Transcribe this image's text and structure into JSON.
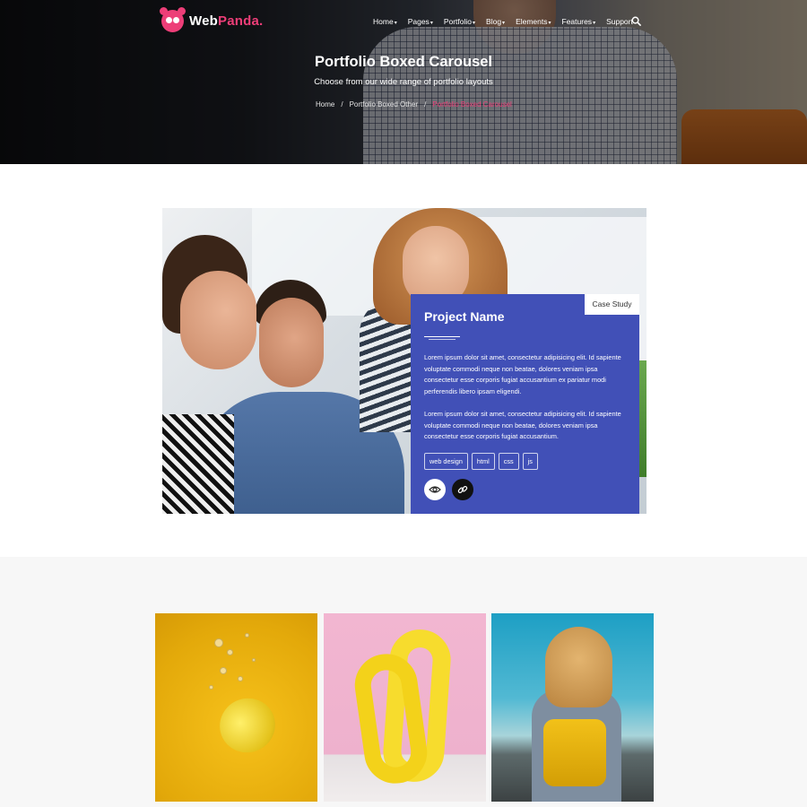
{
  "brand": {
    "name_part1": "Web",
    "name_part2": "Panda.",
    "accent": "#ed3e78"
  },
  "nav": {
    "items": [
      {
        "label": "Home",
        "has_dropdown": true
      },
      {
        "label": "Pages",
        "has_dropdown": true
      },
      {
        "label": "Portfolio",
        "has_dropdown": true
      },
      {
        "label": "Blog",
        "has_dropdown": true
      },
      {
        "label": "Elements",
        "has_dropdown": true
      },
      {
        "label": "Features",
        "has_dropdown": true
      },
      {
        "label": "Support",
        "has_dropdown": false
      }
    ],
    "search_icon": "search-icon"
  },
  "hero": {
    "title": "Portfolio Boxed Carousel",
    "subtitle": "Choose from our wide range of portfolio layouts",
    "breadcrumb": [
      "Home",
      "Portfolio Boxed Other",
      "Portfolio Boxed Carousel"
    ],
    "breadcrumb_separator": "/"
  },
  "project": {
    "badge": "Case Study",
    "title": "Project Name",
    "paragraph1": "Lorem ipsum dolor sit amet, consectetur adipisicing elit. Id sapiente voluptate commodi neque non beatae, dolores veniam ipsa consectetur esse corporis fugiat accusantium ex pariatur modi perferendis libero ipsam eligendi.",
    "paragraph2": "Lorem ipsum dolor sit amet, consectetur adipisicing elit. Id sapiente voluptate commodi neque non beatae, dolores veniam ipsa consectetur esse corporis fugiat accusantium.",
    "tags": [
      "web design",
      "html",
      "css",
      "js"
    ],
    "actions": [
      "eye-icon",
      "link-icon"
    ],
    "panel_color": "#4150b7"
  },
  "gallery": {
    "tiles": [
      "lemon-in-water-image",
      "yellow-balloon-image",
      "girl-with-backpack-image"
    ]
  }
}
